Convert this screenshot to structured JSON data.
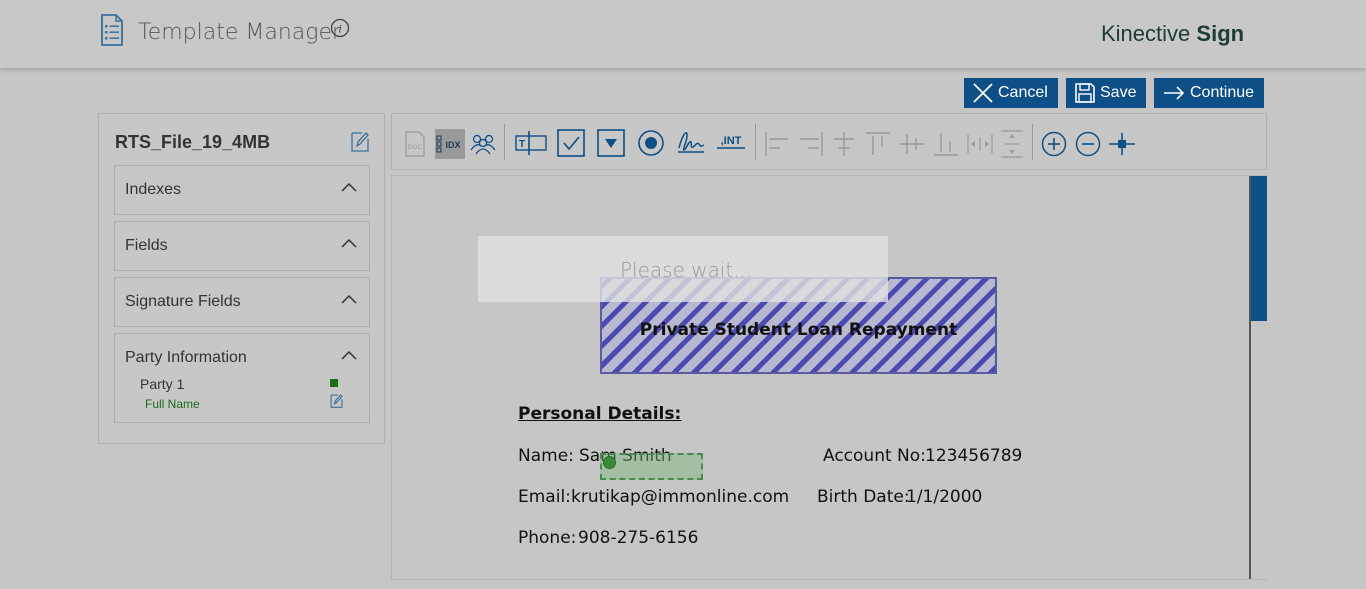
{
  "header": {
    "title": "Template Manager",
    "brand_light": "Kinective",
    "brand_bold": "Sign"
  },
  "actions": {
    "cancel": "Cancel",
    "save": "Save",
    "continue": "Continue"
  },
  "left_panel": {
    "file_name": "RTS_File_19_4MB",
    "sections": [
      "Indexes",
      "Fields",
      "Signature Fields",
      "Party Information"
    ],
    "party": {
      "name": "Party 1",
      "field": "Full Name"
    }
  },
  "toolbar": {
    "doc_label": "DOC",
    "idx_label": "IDX",
    "int_label": ",INT"
  },
  "document": {
    "title": "Private Student Loan Repayment",
    "loading": "Please wait...",
    "section_heading": "Personal Details:",
    "name_label": "Name:",
    "name_value": "Sam Smith",
    "account_label": "Account No:",
    "account_value": "123456789",
    "email_label": "Email:",
    "email_value": "krutikap@immonline.com",
    "birth_label": "Birth Date:",
    "birth_value": "1/1/2000",
    "phone_label": "Phone:",
    "phone_value": "908-275-6156"
  },
  "colors": {
    "primary": "#0d4f86",
    "party": "#1a6b1a"
  }
}
